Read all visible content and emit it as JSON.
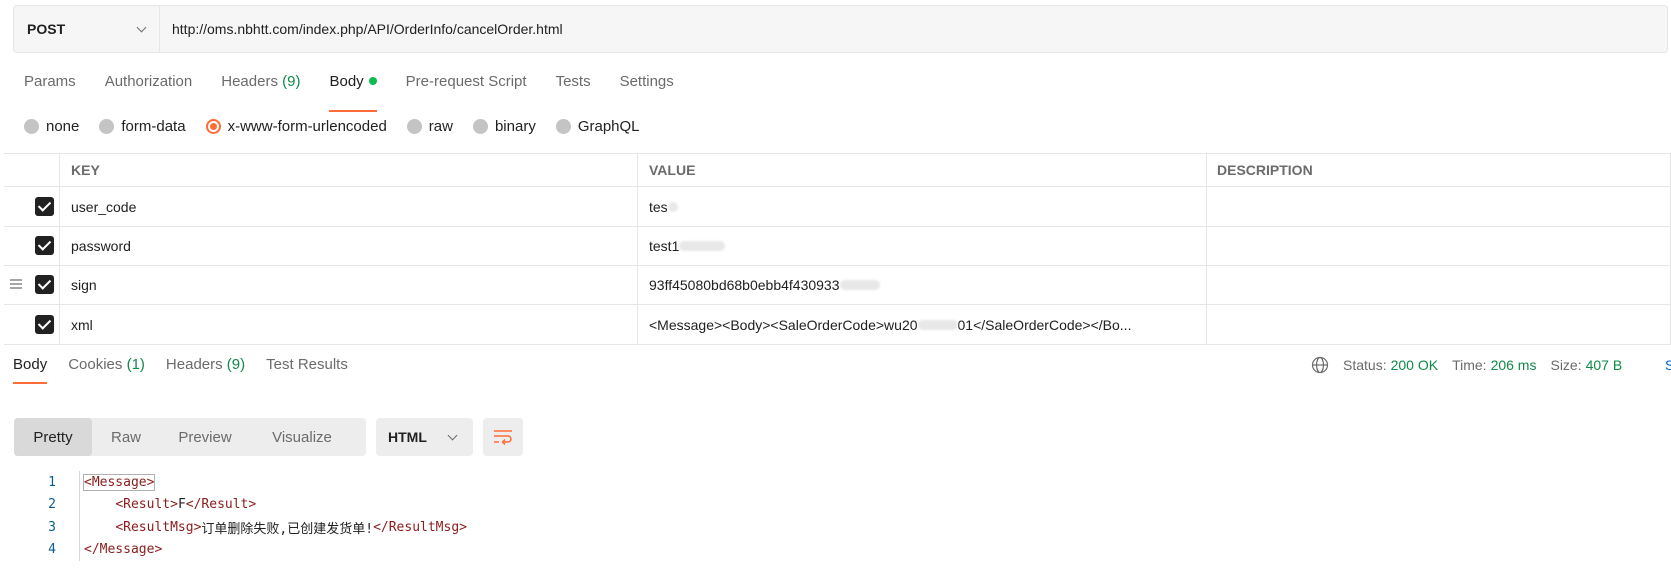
{
  "request": {
    "method": "POST",
    "url": "http://oms.nbhtt.com/index.php/API/OrderInfo/cancelOrder.html"
  },
  "request_tabs": [
    {
      "label": "Params",
      "count": ""
    },
    {
      "label": "Authorization",
      "count": ""
    },
    {
      "label": "Headers",
      "count": "(9)"
    },
    {
      "label": "Body",
      "count": ""
    },
    {
      "label": "Pre-request Script",
      "count": ""
    },
    {
      "label": "Tests",
      "count": ""
    },
    {
      "label": "Settings",
      "count": ""
    }
  ],
  "body_types": [
    {
      "label": "none",
      "selected": false
    },
    {
      "label": "form-data",
      "selected": false
    },
    {
      "label": "x-www-form-urlencoded",
      "selected": true
    },
    {
      "label": "raw",
      "selected": false
    },
    {
      "label": "binary",
      "selected": false
    },
    {
      "label": "GraphQL",
      "selected": false
    }
  ],
  "params_table": {
    "headers": {
      "key": "KEY",
      "value": "VALUE",
      "description": "DESCRIPTION"
    },
    "rows": [
      {
        "key": "user_code",
        "value": "tes",
        "description": "",
        "checked": true
      },
      {
        "key": "password",
        "value": "test1",
        "description": "",
        "checked": true
      },
      {
        "key": "sign",
        "value": "93ff45080bd68b0ebb4f430933",
        "description": "",
        "checked": true
      },
      {
        "key": "xml",
        "value_start": "<Message><Body><SaleOrderCode>wu20",
        "value_end": "01</SaleOrderCode></Bo...",
        "description": "",
        "checked": true
      }
    ]
  },
  "response_tabs": [
    {
      "label": "Body",
      "count": ""
    },
    {
      "label": "Cookies",
      "count": "(1)"
    },
    {
      "label": "Headers",
      "count": "(9)"
    },
    {
      "label": "Test Results",
      "count": ""
    }
  ],
  "response_meta": {
    "status_label": "Status:",
    "status_value": "200 OK",
    "time_label": "Time:",
    "time_value": "206 ms",
    "size_label": "Size:",
    "size_value": "407 B",
    "save_partial": "S"
  },
  "view_modes": [
    "Pretty",
    "Raw",
    "Preview",
    "Visualize"
  ],
  "format": "HTML",
  "code_lines": [
    {
      "num": "1",
      "indent": "",
      "open": "<Message>",
      "text": "",
      "close": ""
    },
    {
      "num": "2",
      "indent": "    ",
      "open": "<Result>",
      "text": "F",
      "close": "</Result>"
    },
    {
      "num": "3",
      "indent": "    ",
      "open": "<ResultMsg>",
      "text": "订单删除失败,已创建发货单!",
      "close": "</ResultMsg>"
    },
    {
      "num": "4",
      "indent": "",
      "open": "</Message>",
      "text": "",
      "close": ""
    }
  ],
  "colors": {
    "accent": "#ff6c37",
    "success": "#0f8a4a",
    "dot": "#0cbb52"
  }
}
